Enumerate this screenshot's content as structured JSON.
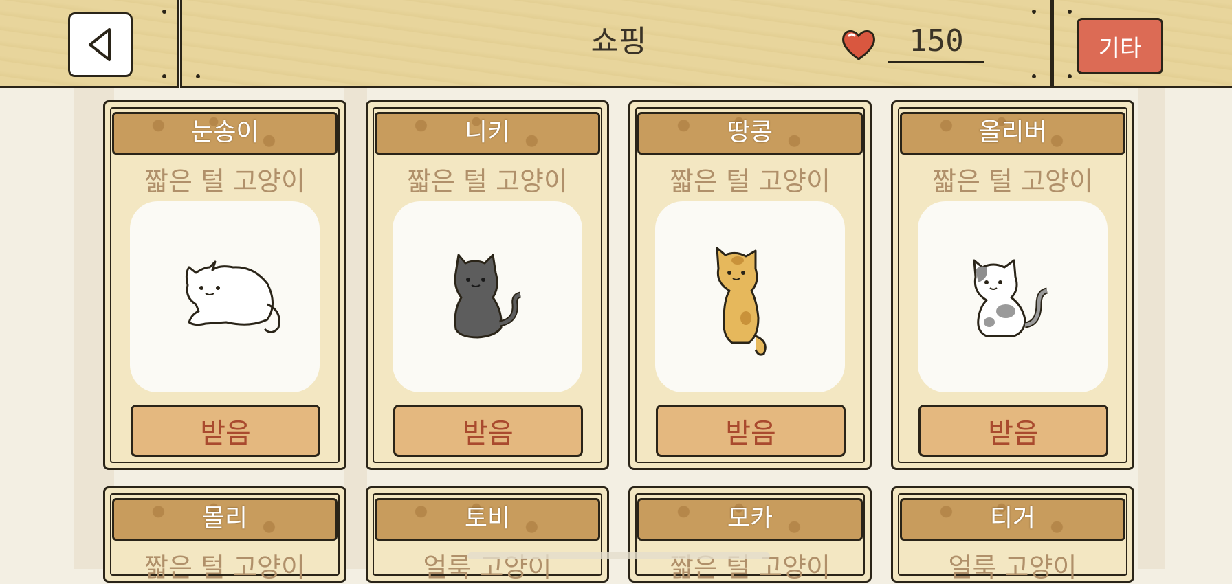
{
  "header": {
    "title": "쇼핑",
    "hearts": "150",
    "misc_label": "기타"
  },
  "cards": [
    {
      "name": "눈송이",
      "breed": "짧은 털 고양이",
      "button": "받음",
      "cat": "white"
    },
    {
      "name": "니키",
      "breed": "짧은 털 고양이",
      "button": "받음",
      "cat": "gray"
    },
    {
      "name": "땅콩",
      "breed": "짧은 털 고양이",
      "button": "받음",
      "cat": "orange"
    },
    {
      "name": "올리버",
      "breed": "짧은 털 고양이",
      "button": "받음",
      "cat": "calico"
    }
  ],
  "cards_row2": [
    {
      "name": "몰리",
      "breed": "짧은 털 고양이"
    },
    {
      "name": "토비",
      "breed": "얼룩 고양이"
    },
    {
      "name": "모카",
      "breed": "짧은 털 고양이"
    },
    {
      "name": "티거",
      "breed": "얼룩 고양이"
    }
  ],
  "colors": {
    "accent": "#dc6b55",
    "button_bg": "#e4b87f",
    "card_bg": "#f3e7c2"
  },
  "icons": [
    "back-arrow-icon",
    "heart-icon"
  ]
}
